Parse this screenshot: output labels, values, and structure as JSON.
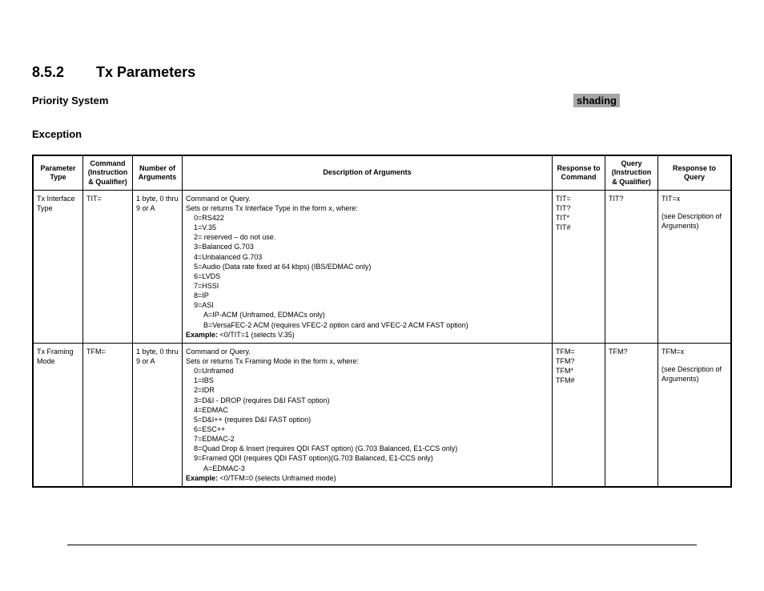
{
  "section": {
    "number": "8.5.2",
    "title": "Tx Parameters"
  },
  "priority": {
    "label": "Priority System",
    "shading": "shading"
  },
  "exception": "Exception",
  "table": {
    "headers": {
      "param_type": "Parameter Type",
      "command": "Command (Instruction & Qualifier)",
      "num_args": "Number of Arguments",
      "desc": "Description of Arguments",
      "resp_cmd": "Response to Command",
      "query": "Query (Instruction & Qualifier)",
      "resp_query": "Response to Query"
    },
    "rows": [
      {
        "param_type": "Tx Interface Type",
        "command": "TIT=",
        "num_args": "1 byte, 0 thru 9 or A",
        "desc_intro": "Command or Query.",
        "desc_sets": "Sets or returns Tx Interface Type in the form x, where:",
        "desc_lines": [
          "0=RS422",
          "1=V.35",
          "2= reserved – do not use.",
          "3=Balanced G.703",
          "4=Unbalanced G.703",
          "5=Audio (Data rate fixed at 64 kbps) (IBS/EDMAC only)",
          "6=LVDS",
          "7=HSSI",
          "8=IP",
          "9=ASI"
        ],
        "desc_sub_lines": [
          "A=IP-ACM (Unframed, EDMACs only)",
          "B=VersaFEC-2 ACM (requires VFEC-2 option card and VFEC-2 ACM FAST option)"
        ],
        "example_label": "Example:",
        "example_text": " <0/TIT=1 (selects V.35)",
        "resp_cmd": "TIT=\nTIT?\nTIT*\nTIT#",
        "query": "TIT?",
        "resp_query_main": "TIT=x",
        "resp_query_note": "(see Description of Arguments)"
      },
      {
        "param_type": "Tx Framing Mode",
        "command": "TFM=",
        "num_args": "1 byte, 0 thru 9 or A",
        "desc_intro": "Command or Query.",
        "desc_sets": "Sets or returns Tx Framing Mode in the form x, where:",
        "desc_lines": [
          "0=Unframed",
          "1=IBS",
          "2=IDR",
          "3=D&I - DROP (requires D&I FAST option)",
          "4=EDMAC",
          "5=D&I++ (requires D&I FAST option)",
          "6=ESC++",
          "7=EDMAC-2",
          "8=Quad Drop & Insert (requires QDI FAST option) (G.703 Balanced, E1-CCS only)",
          "9=Framed QDI (requires QDI FAST option)(G.703 Balanced, E1-CCS only)"
        ],
        "desc_sub_lines": [
          "A=EDMAC-3"
        ],
        "example_label": "Example:",
        "example_text": " <0/TFM=0 (selects Unframed mode)",
        "resp_cmd": "TFM=\nTFM?\nTFM*\nTFM#",
        "query": "TFM?",
        "resp_query_main": "TFM=x",
        "resp_query_note": "(see Description of Arguments)"
      }
    ]
  }
}
